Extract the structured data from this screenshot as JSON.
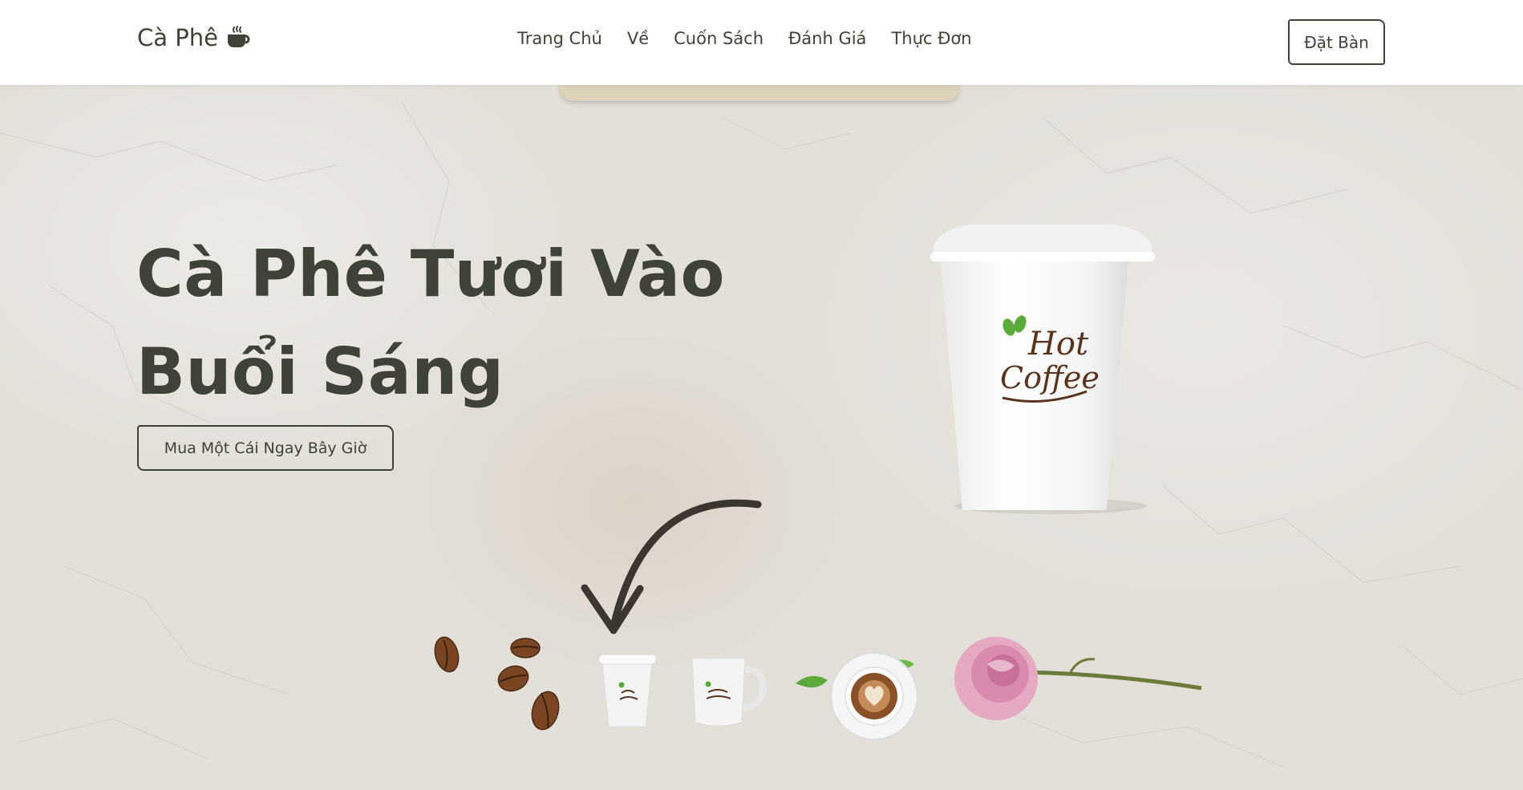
{
  "header": {
    "brand": "Cà Phê",
    "brand_icon": "coffee-cup-icon",
    "nav": [
      "Trang Chủ",
      "Về",
      "Cuốn Sách",
      "Đánh Giá",
      "Thực Đơn"
    ],
    "book_button": "Đặt Bàn"
  },
  "hero": {
    "title_line1": "Cà Phê Tươi Vào",
    "title_line2": "Buổi Sáng",
    "cta_button": "Mua Một Cái Ngay Bây Giờ",
    "cup_logo_line1": "Hot",
    "cup_logo_line2": "Coffee"
  },
  "colors": {
    "text": "#3f4236",
    "background": "#e3e0da",
    "header_bg": "#ffffff",
    "logo_green": "#5bab3a",
    "logo_brown": "#5a3320"
  }
}
